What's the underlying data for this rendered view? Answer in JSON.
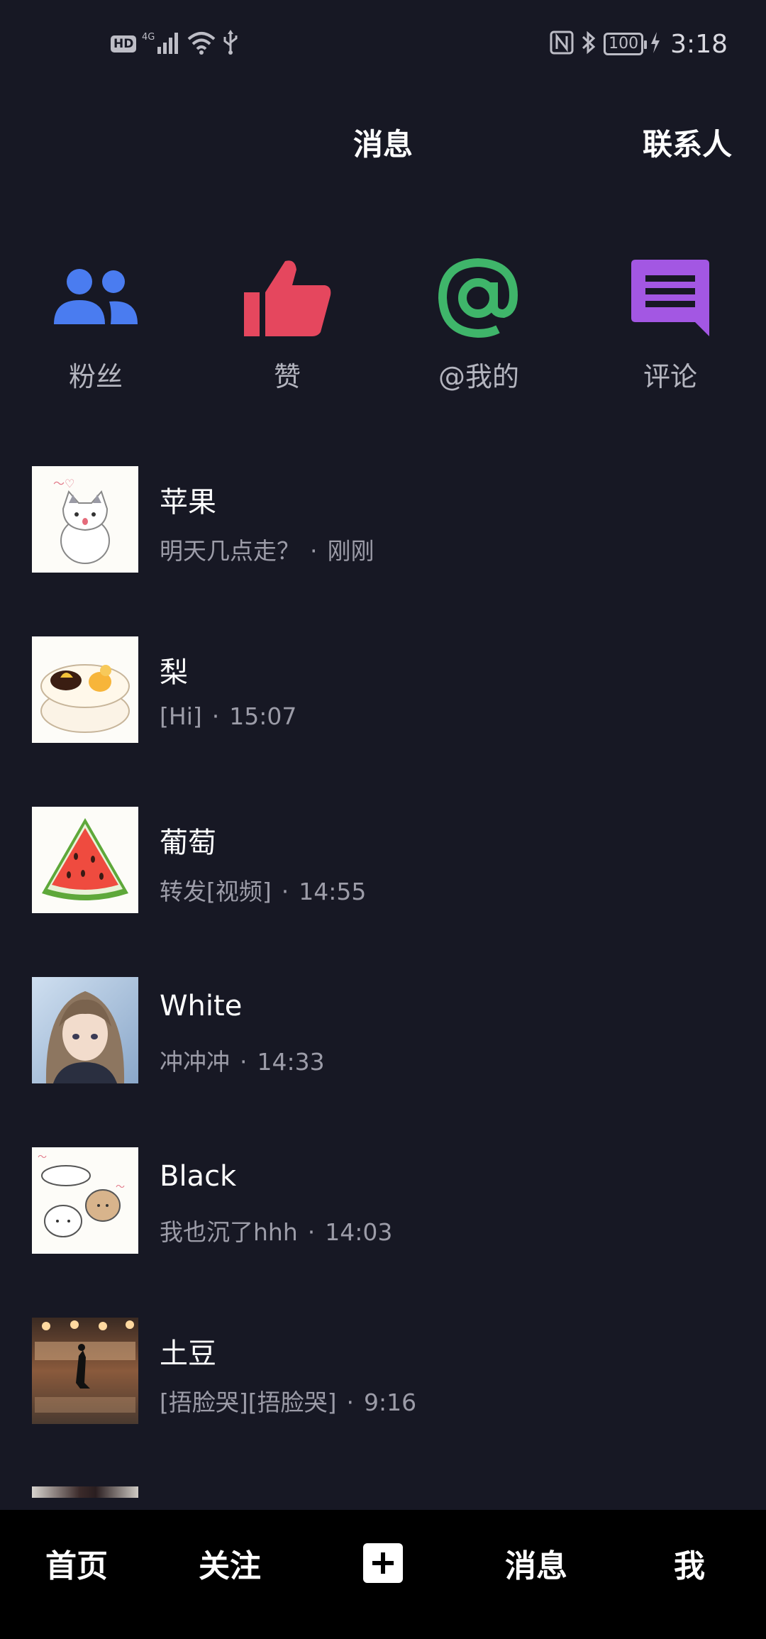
{
  "status_bar": {
    "hd": "HD",
    "network": "4G",
    "battery": "100",
    "time": "3:18"
  },
  "header": {
    "title": "消息",
    "contacts": "联系人"
  },
  "quick_actions": [
    {
      "label": "粉丝",
      "icon": "fans-icon",
      "color": "#4a7cf0"
    },
    {
      "label": "赞",
      "icon": "thumbs-up-icon",
      "color": "#e5475e"
    },
    {
      "label": "@我的",
      "icon": "at-icon",
      "color": "#3fb56a"
    },
    {
      "label": "评论",
      "icon": "comment-icon",
      "color": "#a357e3"
    }
  ],
  "messages": [
    {
      "name": "苹果",
      "preview": "明天几点走？",
      "time": "刚刚"
    },
    {
      "name": "梨",
      "preview": "[Hi]",
      "time": "15:07"
    },
    {
      "name": "葡萄",
      "preview": "转发[视频]",
      "time": "14:55"
    },
    {
      "name": "White",
      "preview": "冲冲冲",
      "time": "14:33"
    },
    {
      "name": "Black",
      "preview": "我也沉了hhh",
      "time": "14:03"
    },
    {
      "name": "土豆",
      "preview": "[捂脸哭][捂脸哭]",
      "time": "9:16"
    }
  ],
  "bottom_nav": {
    "home": "首页",
    "follow": "关注",
    "messages": "消息",
    "me": "我"
  }
}
